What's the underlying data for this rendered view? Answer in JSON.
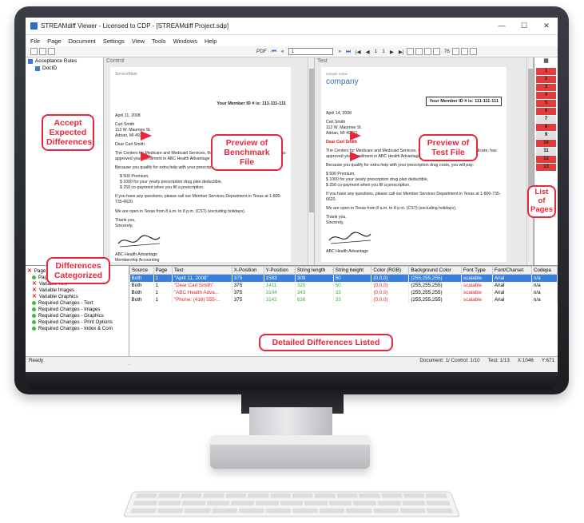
{
  "window": {
    "title": "STREAMdiff Viewer - Licensed to CDP - [STREAMdiff Project.sdp]",
    "controls": {
      "minimize": "—",
      "maximize": "☐",
      "close": "✕"
    }
  },
  "menu": [
    "File",
    "Page",
    "Document",
    "Settings",
    "View",
    "Tools",
    "Windows",
    "Help"
  ],
  "toolbar": {
    "pdf_label": "PDF",
    "page_input": "1",
    "page_of": "1",
    "page_total": "1",
    "zoom": "76"
  },
  "left_panel": {
    "root": "Acceptance Rules",
    "child": "DocID"
  },
  "control_pane": {
    "header": "Control",
    "logo": "ServiceMark",
    "member_id": "Your Member ID # is: 111-111-111",
    "date": "April 11, 2008",
    "addr": [
      "Carl Smith",
      "113 W. Maumee St.",
      "Adrian, MI 49221"
    ],
    "salutation": "Dear Carl Smith",
    "p1": "The Centers for Medicare and Medicaid Services, the federal agency that runs Medicare, has approved your enrollment in ABC Health Advantage beginning May 1, 2008.",
    "p2": "Because you qualify for extra help with your prescription drug costs, you will pay:",
    "items": [
      "$ 500 Premium,",
      "$ 1000 for your yearly prescription drug plan deductible,",
      "$ 250 co-payment when you fill a prescription."
    ],
    "p3": "If you have any questions, please call our Member Services Department in Texas at 1-800-735-6620.",
    "p4": "We are open in Texas from 8 a.m. to 8 p.m. (CST) (excluding holidays).",
    "closing": [
      "Thank you,",
      "Sincerely,"
    ],
    "sign_org": "ABC Health Advantage",
    "sign_sub": "Membership Accounting"
  },
  "test_pane": {
    "header": "Test",
    "logo_small": "sample name",
    "logo": "company",
    "member_id": "Your Member ID # is: 111-111-111",
    "date": "April 14, 2008",
    "addr": [
      "Carl Smith",
      "113 W. Maumee St.",
      "Adrian, MI 49221"
    ],
    "salutation": "Dear Carl Smith",
    "p1": "The Centers for Medicare and Medicaid Services, the federal agency that runs Medicare, has approved your enrollment in ABC Health Advantage beginning May 1, 2008.",
    "p2": "Because you qualify for extra help with your prescription drug costs, you will pay:",
    "items": [
      "$ 500 Premium,",
      "$ 1000 for your yearly prescription drug plan deductible,",
      "$ 250 co-payment when you fill a prescription."
    ],
    "p3": "If you have any questions, please call our Member Services Department in Texas at 1-800-735-6620.",
    "p4": "We are open in Texas from 8 a.m. to 8 p.m. (CST) (excluding holidays).",
    "closing": [
      "Thank you,",
      "Sincerely,"
    ],
    "sign_org": "ABC Health Advantage"
  },
  "pages": [
    {
      "n": "1",
      "c": "red"
    },
    {
      "n": "2",
      "c": "red"
    },
    {
      "n": "3",
      "c": "red"
    },
    {
      "n": "4",
      "c": "red"
    },
    {
      "n": "5",
      "c": "red"
    },
    {
      "n": "6",
      "c": "red"
    },
    {
      "n": "7",
      "c": "gray"
    },
    {
      "n": "8",
      "c": "red"
    },
    {
      "n": "9",
      "c": "gray"
    },
    {
      "n": "10",
      "c": "red"
    },
    {
      "n": "11",
      "c": "gray"
    },
    {
      "n": "12",
      "c": "red"
    },
    {
      "n": "13",
      "c": "red"
    }
  ],
  "categories": {
    "root": "Page '1'",
    "items": [
      {
        "label": "Page Attributes",
        "type": "dot"
      },
      {
        "label": "Variable Text",
        "type": "x"
      },
      {
        "label": "Variable Images",
        "type": "x"
      },
      {
        "label": "Variable Graphics",
        "type": "x"
      },
      {
        "label": "Required Changes - Text",
        "type": "dot"
      },
      {
        "label": "Required Changes - Images",
        "type": "dot"
      },
      {
        "label": "Required Changes - Graphics",
        "type": "dot"
      },
      {
        "label": "Required Changes - Print Options",
        "type": "dot"
      },
      {
        "label": "Required Changes - Index & Com",
        "type": "dot"
      }
    ]
  },
  "diff_table": {
    "headers": [
      "Source",
      "Page",
      "Text",
      "X-Position",
      "Y-Position",
      "String length",
      "String height",
      "Color (RGB)",
      "Background Color",
      "Font Type",
      "Font/Charset",
      "Codepa"
    ],
    "rows": [
      [
        "Both",
        "1",
        "\"April 11, 2008\"",
        "375",
        "1583",
        "309",
        "50",
        "(0,0,0)",
        "(255,255,255)",
        "scalable",
        "Arial",
        "n/a"
      ],
      [
        "Both",
        "1",
        "\"Dear Carl Smith\"",
        "375",
        "1411",
        "320",
        "50",
        "(0,0,0)",
        "(255,255,255)",
        "scalable",
        "Arial",
        "n/a"
      ],
      [
        "Both",
        "1",
        "\"ABC Health Adva...",
        "375",
        "3104",
        "343",
        "33",
        "(0,0,0)",
        "(255,255,255)",
        "scalable",
        "Arial",
        "n/a"
      ],
      [
        "Both",
        "1",
        "\"Phone: (416) 555-...",
        "375",
        "3142",
        "636",
        "33",
        "(0,0,0)",
        "(255,255,255)",
        "scalable",
        "Arial",
        "n/a"
      ]
    ]
  },
  "status": {
    "left": "Ready",
    "doc": "Document: 1/ Control: 1/10",
    "test": "Test: 1/13",
    "x": "X:1046",
    "y": "Y:671"
  },
  "callouts": {
    "accept": "Accept Expected Differences",
    "benchmark": "Preview of Benchmark File",
    "test": "Preview of Test File",
    "categorized": "Differences Categorized",
    "listed": "Detailed Differences Listed",
    "pages": "List of Pages"
  },
  "colors": {
    "callout": "#e8283a",
    "selection": "#3a7fdc",
    "diff_red": "#e02020",
    "diff_green": "#36b336"
  }
}
